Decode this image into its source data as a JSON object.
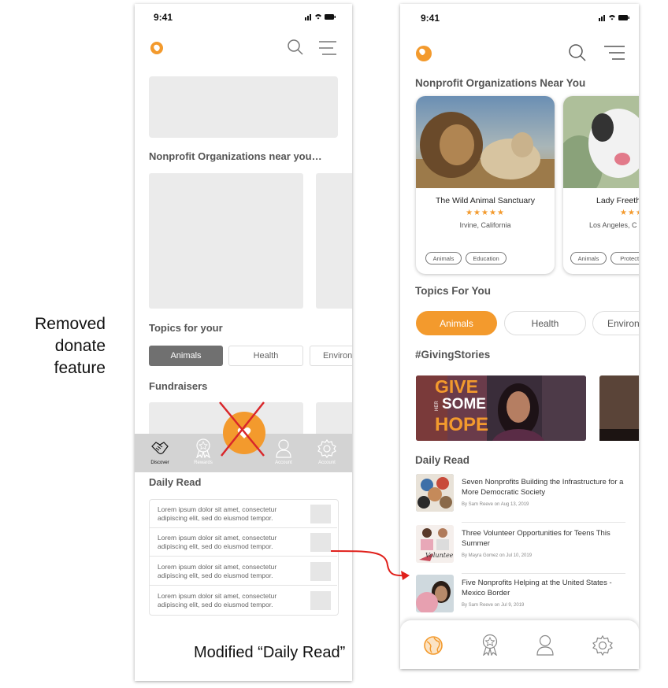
{
  "annotations": {
    "removed_line1": "Removed",
    "removed_line2": "donate",
    "removed_line3": "feature",
    "modified": "Modified “Daily Read”"
  },
  "wireframe": {
    "status_time": "9:41",
    "section_nonprofits": "Nonprofit Organizations near you…",
    "section_topics": "Topics for your",
    "topics": [
      "Animals",
      "Health",
      "Environ"
    ],
    "section_fundraisers": "Fundraisers",
    "nav": [
      "Discover",
      "Rewards",
      "Account",
      "Account"
    ],
    "section_daily": "Daily Read",
    "daily_rows": [
      "Lorem ipsum dolor sit amet, consectetur adipiscing elit, sed do eiusmod tempor.",
      "Lorem ipsum dolor sit amet, consectetur adipiscing elit, sed do eiusmod tempor.",
      "Lorem ipsum dolor sit amet, consectetur adipiscing elit, sed do eiusmod tempor.",
      "Lorem ipsum dolor sit amet, consectetur adipiscing elit, sed do eiusmod tempor."
    ]
  },
  "hifi": {
    "status_time": "9:41",
    "section_nonprofits": "Nonprofit Organizations Near You",
    "cards": [
      {
        "name": "The Wild Animal Sanctuary",
        "stars": "★★★★★",
        "location": "Irvine, California",
        "tags": [
          "Animals",
          "Education"
        ]
      },
      {
        "name": "Lady Freeth",
        "stars": "★★★",
        "location": "Los Angeles, C",
        "tags": [
          "Animals",
          "Protecti"
        ]
      }
    ],
    "section_topics": "Topics For You",
    "topics": [
      "Animals",
      "Health",
      "Environ"
    ],
    "section_stories": "#GivingStories",
    "story_text": {
      "line1": "GIVE",
      "small": "HER",
      "line2": "SOME",
      "line3": "HOPE"
    },
    "section_daily": "Daily Read",
    "articles": [
      {
        "title": "Seven Nonprofits Building the Infrastructure for a More Democratic Society",
        "byline": "By Sam Reeve on Aug 13, 2019"
      },
      {
        "title": "Three Volunteer Opportunities for Teens This Summer",
        "byline": "By Mayra Gomez on Jul 10, 2019",
        "thumb_text": "Volunteer"
      },
      {
        "title": "Five Nonprofits Helping at the United States - Mexico Border",
        "byline": "By Sam Reeve on Jul 9, 2019"
      }
    ]
  },
  "colors": {
    "accent": "#f39a2d",
    "arrow": "#e0201b",
    "cross": "#d9262a",
    "wire_gray": "#ebebeb",
    "nav_gray": "#d3d3d3",
    "pill_dark": "#707070"
  }
}
